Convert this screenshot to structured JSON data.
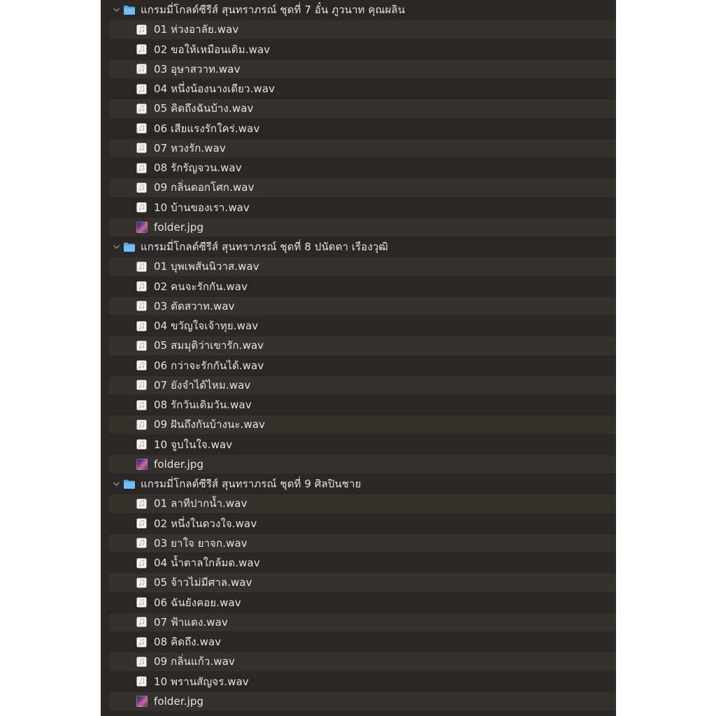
{
  "groups": [
    {
      "folder_name": "แกรมมี่โกลด์ซีรีส์ สุนทราภรณ์ ชุดที่ 7 อั๋น ภูวนาท คุณผลิน",
      "files": [
        {
          "name": "01  ห่วงอาลัย.wav",
          "kind": "audio"
        },
        {
          "name": "02 ขอให้เหมือนเดิม.wav",
          "kind": "audio"
        },
        {
          "name": "03  อุษาสวาท.wav",
          "kind": "audio"
        },
        {
          "name": "04  หนึ่งน้องนางเดียว.wav",
          "kind": "audio"
        },
        {
          "name": "05 คิดถึงฉันบ้าง.wav",
          "kind": "audio"
        },
        {
          "name": "06 เสียแรงรักใคร่.wav",
          "kind": "audio"
        },
        {
          "name": "07 หวงรัก.wav",
          "kind": "audio"
        },
        {
          "name": "08  รักรัญจวน.wav",
          "kind": "audio"
        },
        {
          "name": "09 กลิ่นดอกโศก.wav",
          "kind": "audio"
        },
        {
          "name": "10 บ้านของเรา.wav",
          "kind": "audio"
        },
        {
          "name": "folder.jpg",
          "kind": "image"
        }
      ]
    },
    {
      "folder_name": "แกรมมี่โกลด์ซีรีส์ สุนทราภรณ์ ชุดที่ 8 ปนัดดา เรืองวุฒิ",
      "files": [
        {
          "name": "01 บุพเพสันนิวาส.wav",
          "kind": "audio"
        },
        {
          "name": "02 คนจะรักกัน.wav",
          "kind": "audio"
        },
        {
          "name": "03 ตัดสวาท.wav",
          "kind": "audio"
        },
        {
          "name": "04 ขวัญใจเจ้าทุย.wav",
          "kind": "audio"
        },
        {
          "name": "05 สมมุติว่าเขารัก.wav",
          "kind": "audio"
        },
        {
          "name": "06 กว่าจะรักกันได้.wav",
          "kind": "audio"
        },
        {
          "name": "07 ยังจำได้ไหม.wav",
          "kind": "audio"
        },
        {
          "name": "08 รักวันเดิมวัน.wav",
          "kind": "audio"
        },
        {
          "name": "09 ฝันถึงกันบ้างนะ.wav",
          "kind": "audio"
        },
        {
          "name": "10 จูบในใจ.wav",
          "kind": "audio"
        },
        {
          "name": "folder.jpg",
          "kind": "image"
        }
      ]
    },
    {
      "folder_name": "แกรมมี่โกลด์ซีรีส์ สุนทราภรณ์ ชุดที่ 9 ศิลปินชาย",
      "files": [
        {
          "name": "01 ลาทีปากน้ำ.wav",
          "kind": "audio"
        },
        {
          "name": "02 หนึ่งในดวงใจ.wav",
          "kind": "audio"
        },
        {
          "name": "03 ยาใจ ยาจก.wav",
          "kind": "audio"
        },
        {
          "name": "04 น้ำตาลใกล้มด.wav",
          "kind": "audio"
        },
        {
          "name": "05 จ้าวไม่มีศาล.wav",
          "kind": "audio"
        },
        {
          "name": "06 ฉันยังคอย.wav",
          "kind": "audio"
        },
        {
          "name": "07 ฟ้าแดง.wav",
          "kind": "audio"
        },
        {
          "name": "08 คิดถึง.wav",
          "kind": "audio"
        },
        {
          "name": "09 กลิ่นแก้ว.wav",
          "kind": "audio"
        },
        {
          "name": "10 พรานสัญจร.wav",
          "kind": "audio"
        },
        {
          "name": "folder.jpg",
          "kind": "image"
        }
      ]
    }
  ],
  "icons": {
    "folder": "folder-icon",
    "audio": "audio-file-icon",
    "image": "image-thumbnail-icon",
    "chevron": "chevron-down-icon"
  },
  "colors": {
    "background": "#2a2724",
    "row_stripe": "#35322e",
    "text": "#e6e4e1",
    "folder_blue": "#5fb4ee"
  }
}
